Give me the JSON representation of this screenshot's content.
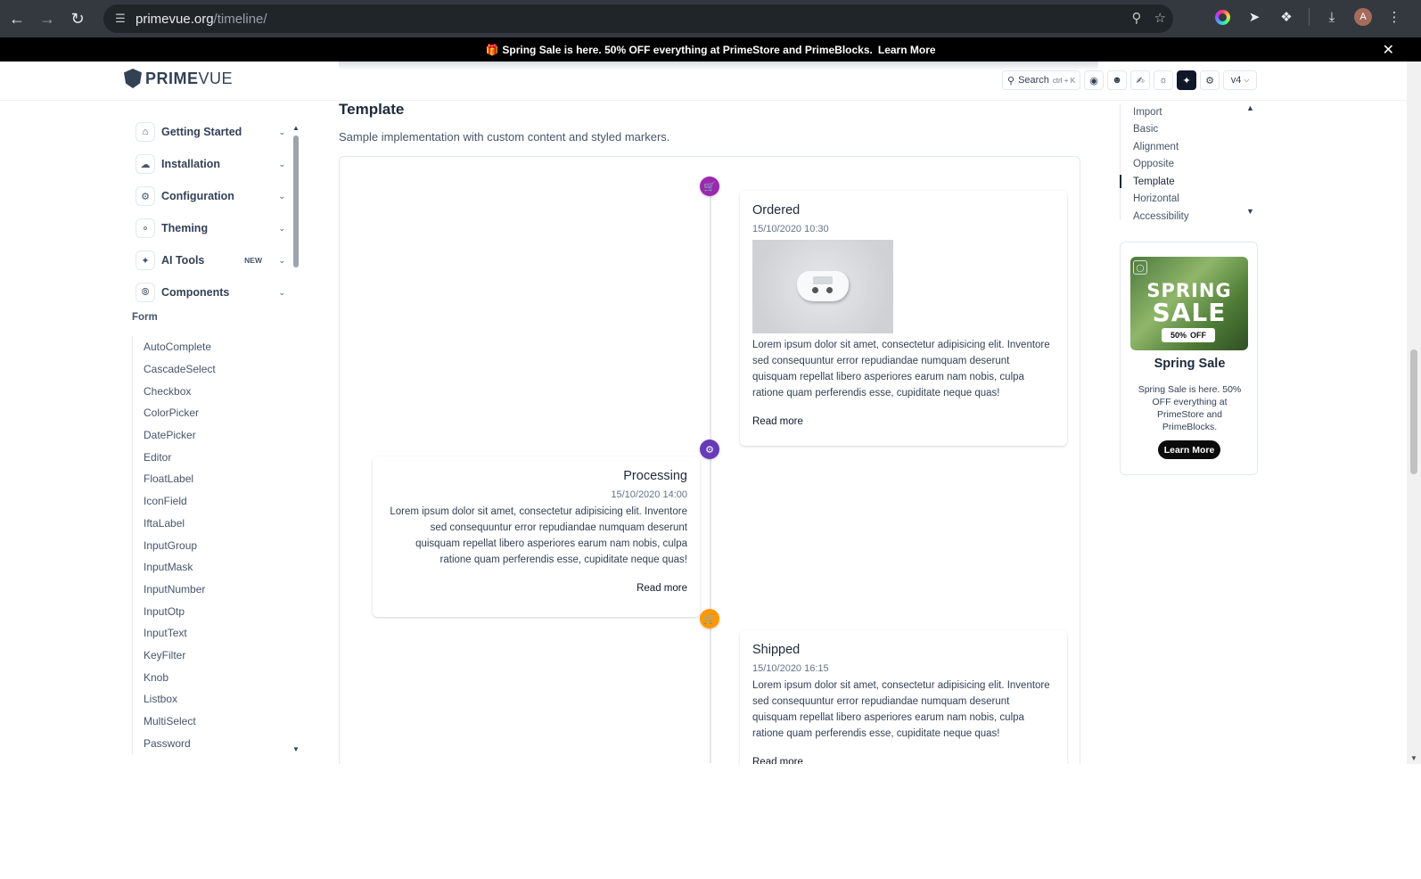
{
  "browser": {
    "url_host": "primevue.org",
    "url_path": "/timeline/",
    "avatar_letter": "A"
  },
  "banner": {
    "text": "Spring Sale is here. 50% OFF everything at PrimeStore and PrimeBlocks.",
    "link": "Learn More"
  },
  "header": {
    "logo_bold": "PRIME",
    "logo_light": "VUE",
    "search_label": "Search",
    "search_shortcut": "ctrl + K",
    "version": "v4"
  },
  "sidebar": {
    "menu": [
      {
        "label": "Getting Started",
        "icon": "home-icon"
      },
      {
        "label": "Installation",
        "icon": "download-icon"
      },
      {
        "label": "Configuration",
        "icon": "gear-icon"
      },
      {
        "label": "Theming",
        "icon": "palette-icon"
      },
      {
        "label": "AI Tools",
        "icon": "sparkle-icon",
        "badge": "NEW"
      },
      {
        "label": "Components",
        "icon": "compass-icon"
      }
    ],
    "group": "Form",
    "form_items": [
      "AutoComplete",
      "CascadeSelect",
      "Checkbox",
      "ColorPicker",
      "DatePicker",
      "Editor",
      "FloatLabel",
      "IconField",
      "IftaLabel",
      "InputGroup",
      "InputMask",
      "InputNumber",
      "InputOtp",
      "InputText",
      "KeyFilter",
      "Knob",
      "Listbox",
      "MultiSelect",
      "Password"
    ]
  },
  "main": {
    "title": "Template",
    "description": "Sample implementation with custom content and styled markers.",
    "events": [
      {
        "status": "Ordered",
        "date": "15/10/2020 10:30",
        "color": "#9C27B0",
        "icon": "shopping-cart-icon",
        "body": "Lorem ipsum dolor sit amet, consectetur adipisicing elit. Inventore sed consequuntur error repudiandae numquam deserunt quisquam repellat libero asperiores earum nam nobis, culpa ratione quam perferendis esse, cupiditate neque quas!",
        "button": "Read more"
      },
      {
        "status": "Processing",
        "date": "15/10/2020 14:00",
        "color": "#673AB7",
        "icon": "cog-icon",
        "body": "Lorem ipsum dolor sit amet, consectetur adipisicing elit. Inventore sed consequuntur error repudiandae numquam deserunt quisquam repellat libero asperiores earum nam nobis, culpa ratione quam perferendis esse, cupiditate neque quas!",
        "button": "Read more"
      },
      {
        "status": "Shipped",
        "date": "15/10/2020 16:15",
        "color": "#FF9800",
        "icon": "shopping-cart-icon",
        "body": "Lorem ipsum dolor sit amet, consectetur adipisicing elit. Inventore sed consequuntur error repudiandae numquam deserunt quisquam repellat libero asperiores earum nam nobis, culpa ratione quam perferendis esse, cupiditate neque quas!",
        "button": "Read more"
      }
    ]
  },
  "toc": {
    "items": [
      "Import",
      "Basic",
      "Alignment",
      "Opposite",
      "Template",
      "Horizontal",
      "Accessibility"
    ],
    "active": "Template"
  },
  "ad": {
    "image_line1": "SPRING",
    "image_line2": "SALE",
    "image_pct": "50%",
    "image_off": "OFF",
    "title": "Spring Sale",
    "text": "Spring Sale is here. 50% OFF everything at PrimeStore and PrimeBlocks.",
    "button": "Learn More"
  }
}
